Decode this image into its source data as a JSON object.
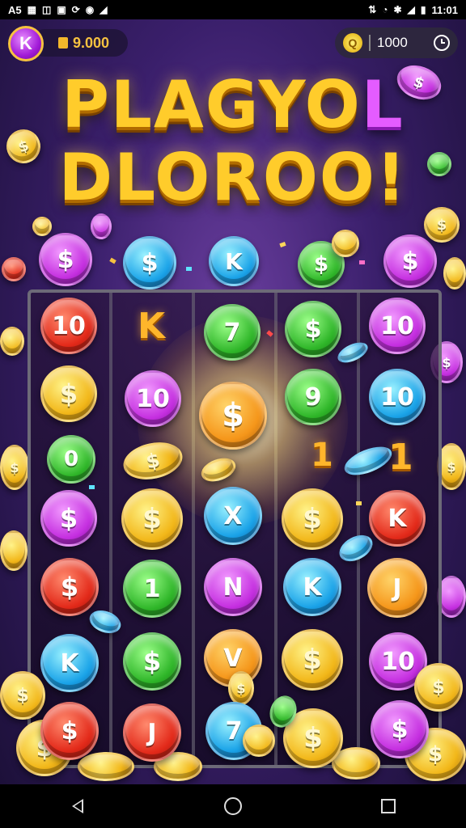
{
  "status_bar": {
    "left_icons": [
      "A5",
      "chart-icon",
      "signal-icon",
      "image-icon",
      "sync-icon",
      "play-icon",
      "network-icon"
    ],
    "left_label": "A5",
    "time": "11:01"
  },
  "header": {
    "avatar_letter": "K",
    "gold_amount": "9.000",
    "timer_coin_letter": "Q",
    "timer_value": "1000"
  },
  "title": {
    "line1": "PLAGYOL",
    "line1_accent": "L",
    "line2": "DLOROO!"
  },
  "colors": {
    "red": "#e32a1a",
    "gold": "#f2b719",
    "green": "#2fb629",
    "purple": "#c52fe0",
    "blue": "#1aa3e8",
    "orange": "#f5961a",
    "title": "#ffcc2b"
  },
  "top_coins": [
    {
      "label": "$",
      "color": "purple"
    },
    {
      "label": "$",
      "color": "blue"
    },
    {
      "label": "K",
      "color": "blue"
    },
    {
      "label": "$",
      "color": "green"
    },
    {
      "label": "$",
      "color": "purple"
    }
  ],
  "grid": [
    [
      {
        "label": "10",
        "color": "red"
      },
      {
        "label": "K",
        "color": "none"
      },
      {
        "label": "7",
        "color": "green"
      },
      {
        "label": "$",
        "color": "green"
      },
      {
        "label": "10",
        "color": "purple"
      }
    ],
    [
      {
        "label": "$",
        "color": "gold"
      },
      {
        "label": "10",
        "color": "purple"
      },
      {
        "label": "$",
        "color": "orange"
      },
      {
        "label": "9",
        "color": "green"
      },
      {
        "label": "10",
        "color": "blue"
      }
    ],
    [
      {
        "label": "0",
        "color": "green"
      },
      {
        "label": "$",
        "color": "gold"
      },
      {
        "label": "",
        "color": "none"
      },
      {
        "label": "1",
        "color": "none"
      },
      {
        "label": "1",
        "color": "none"
      }
    ],
    [
      {
        "label": "$",
        "color": "purple"
      },
      {
        "label": "$",
        "color": "gold"
      },
      {
        "label": "X",
        "color": "blue"
      },
      {
        "label": "$",
        "color": "gold"
      },
      {
        "label": "K",
        "color": "red"
      }
    ],
    [
      {
        "label": "$",
        "color": "red"
      },
      {
        "label": "1",
        "color": "green"
      },
      {
        "label": "N",
        "color": "purple"
      },
      {
        "label": "K",
        "color": "blue"
      },
      {
        "label": "J",
        "color": "orange"
      }
    ],
    [
      {
        "label": "K",
        "color": "blue"
      },
      {
        "label": "$",
        "color": "green"
      },
      {
        "label": "V",
        "color": "orange"
      },
      {
        "label": "$",
        "color": "gold"
      },
      {
        "label": "10",
        "color": "purple"
      }
    ],
    [
      {
        "label": "$",
        "color": "red"
      },
      {
        "label": "J",
        "color": "red"
      },
      {
        "label": "7",
        "color": "blue"
      },
      {
        "label": "$",
        "color": "gold"
      },
      {
        "label": "$",
        "color": "purple"
      }
    ]
  ],
  "nav": [
    "back-icon",
    "home-icon",
    "recents-icon"
  ]
}
